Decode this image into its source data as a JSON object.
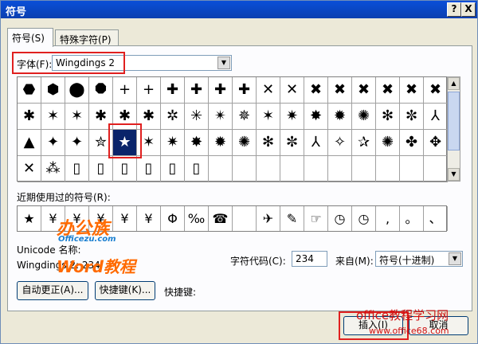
{
  "window": {
    "title": "符号",
    "help_btn": "?",
    "close_btn": "X"
  },
  "tabs": [
    {
      "label": "符号(S)"
    },
    {
      "label": "特殊字符(P)"
    }
  ],
  "font": {
    "label": "字体(F):",
    "value": "Wingdings 2"
  },
  "symbol_grid": {
    "rows": [
      [
        "⬣",
        "⬢",
        "⬤",
        "⯃",
        "+",
        "+",
        "✚",
        "✚",
        "✚",
        "✚",
        "✕",
        "✕",
        "✖",
        "✖",
        "✖",
        "✖",
        "✖",
        "✖"
      ],
      [
        "✱",
        "✶",
        "✶",
        "✱",
        "✱",
        "✱",
        "✲",
        "✳",
        "✴",
        "✵",
        "✶",
        "✷",
        "✸",
        "✹",
        "✺",
        "✻",
        "✼",
        "⅄"
      ],
      [
        "▲",
        "✦",
        "✦",
        "✮",
        "★",
        "✶",
        "✷",
        "✸",
        "✹",
        "✺",
        "✻",
        "✼",
        "⅄",
        "✧",
        "✰",
        "✺",
        "✤",
        "✥"
      ],
      [
        "✕",
        "⁂",
        "▯",
        "▯",
        "▯",
        "▯",
        "▯",
        "▯",
        "",
        "",
        "",
        "",
        "",
        "",
        "",
        "",
        "",
        ""
      ]
    ],
    "selected_index": 4
  },
  "scrollbar": {
    "up_arrow": "▲",
    "down_arrow": "▼"
  },
  "recent": {
    "label": "近期使用过的符号(R):",
    "symbols": [
      "★",
      "¥",
      "¥",
      "¥",
      "¥",
      "¥",
      "Φ",
      "‰",
      "☎",
      "",
      "✈",
      "✎",
      "☞",
      "◷",
      "◷",
      ",",
      "。",
      "、"
    ]
  },
  "unicode_name": {
    "label": "Unicode 名称:",
    "value": "Wingdings 2: 234"
  },
  "char_code": {
    "label": "字符代码(C):",
    "value": "234"
  },
  "from": {
    "label": "来自(M):",
    "value": "符号(十进制)"
  },
  "buttons": {
    "autocorrect": "自动更正(A)...",
    "shortcut_key": "快捷键(K)...",
    "shortcut_label": "快捷键:",
    "insert": "插入(I)",
    "cancel": "取消"
  },
  "watermarks": {
    "w1": "办公族",
    "w2": "Officezu.com",
    "w3": "Word教程",
    "w4": "office教程学习网",
    "w5": "www.office68.com"
  }
}
